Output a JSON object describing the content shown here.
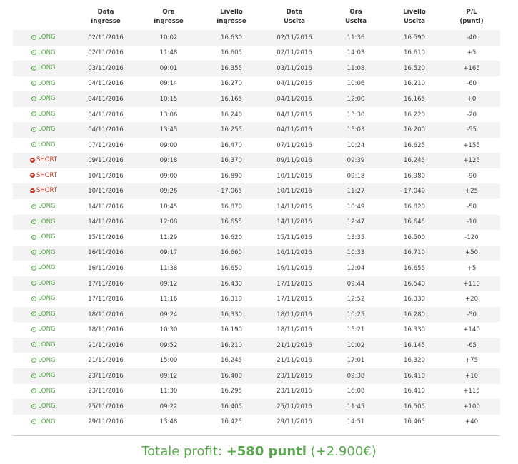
{
  "colors": {
    "positive": "#5aa84d",
    "negative": "#c0392b",
    "row_alt": "#f3f3f3"
  },
  "headers": {
    "direction": "",
    "entry_date": [
      "Data",
      "Ingresso"
    ],
    "entry_time": [
      "Ora",
      "Ingresso"
    ],
    "entry_level": [
      "Livello",
      "Ingresso"
    ],
    "exit_date": [
      "Data",
      "Uscita"
    ],
    "exit_time": [
      "Ora",
      "Uscita"
    ],
    "exit_level": [
      "Livello",
      "Uscita"
    ],
    "pl": [
      "P/L",
      "(punti)"
    ]
  },
  "trades": [
    {
      "dir": "LONG",
      "entry_date": "02/11/2016",
      "entry_time": "10:02",
      "entry_level": "16.630",
      "exit_date": "02/11/2016",
      "exit_time": "11:36",
      "exit_level": "16.590",
      "pl": "-40"
    },
    {
      "dir": "LONG",
      "entry_date": "02/11/2016",
      "entry_time": "11:48",
      "entry_level": "16.605",
      "exit_date": "02/11/2016",
      "exit_time": "14:03",
      "exit_level": "16.610",
      "pl": "+5"
    },
    {
      "dir": "LONG",
      "entry_date": "03/11/2016",
      "entry_time": "09:01",
      "entry_level": "16.355",
      "exit_date": "03/11/2016",
      "exit_time": "11:08",
      "exit_level": "16.520",
      "pl": "+165"
    },
    {
      "dir": "LONG",
      "entry_date": "04/11/2016",
      "entry_time": "09:14",
      "entry_level": "16.270",
      "exit_date": "04/11/2016",
      "exit_time": "10:06",
      "exit_level": "16.210",
      "pl": "-60"
    },
    {
      "dir": "LONG",
      "entry_date": "04/11/2016",
      "entry_time": "10:15",
      "entry_level": "16.165",
      "exit_date": "04/11/2016",
      "exit_time": "12:00",
      "exit_level": "16.165",
      "pl": "+0"
    },
    {
      "dir": "LONG",
      "entry_date": "04/11/2016",
      "entry_time": "13:06",
      "entry_level": "16.240",
      "exit_date": "04/11/2016",
      "exit_time": "13:30",
      "exit_level": "16.220",
      "pl": "-20"
    },
    {
      "dir": "LONG",
      "entry_date": "04/11/2016",
      "entry_time": "13:45",
      "entry_level": "16.255",
      "exit_date": "04/11/2016",
      "exit_time": "15:03",
      "exit_level": "16.200",
      "pl": "-55"
    },
    {
      "dir": "LONG",
      "entry_date": "07/11/2016",
      "entry_time": "09:00",
      "entry_level": "16.470",
      "exit_date": "07/11/2016",
      "exit_time": "10:24",
      "exit_level": "16.625",
      "pl": "+155"
    },
    {
      "dir": "SHORT",
      "entry_date": "09/11/2016",
      "entry_time": "09:18",
      "entry_level": "16.370",
      "exit_date": "09/11/2016",
      "exit_time": "09:39",
      "exit_level": "16.245",
      "pl": "+125"
    },
    {
      "dir": "SHORT",
      "entry_date": "10/11/2016",
      "entry_time": "09:00",
      "entry_level": "16.890",
      "exit_date": "10/11/2016",
      "exit_time": "09:18",
      "exit_level": "16.980",
      "pl": "-90"
    },
    {
      "dir": "SHORT",
      "entry_date": "10/11/2016",
      "entry_time": "09:26",
      "entry_level": "17.065",
      "exit_date": "10/11/2016",
      "exit_time": "11:27",
      "exit_level": "17.040",
      "pl": "+25"
    },
    {
      "dir": "LONG",
      "entry_date": "14/11/2016",
      "entry_time": "10:45",
      "entry_level": "16.870",
      "exit_date": "14/11/2016",
      "exit_time": "10:49",
      "exit_level": "16.820",
      "pl": "-50"
    },
    {
      "dir": "LONG",
      "entry_date": "14/11/2016",
      "entry_time": "12:08",
      "entry_level": "16.655",
      "exit_date": "14/11/2016",
      "exit_time": "12:47",
      "exit_level": "16.645",
      "pl": "-10"
    },
    {
      "dir": "LONG",
      "entry_date": "15/11/2016",
      "entry_time": "11:29",
      "entry_level": "16.620",
      "exit_date": "15/11/2016",
      "exit_time": "13:35",
      "exit_level": "16.500",
      "pl": "-120"
    },
    {
      "dir": "LONG",
      "entry_date": "16/11/2016",
      "entry_time": "09:17",
      "entry_level": "16.660",
      "exit_date": "16/11/2016",
      "exit_time": "10:33",
      "exit_level": "16.710",
      "pl": "+50"
    },
    {
      "dir": "LONG",
      "entry_date": "16/11/2016",
      "entry_time": "11:38",
      "entry_level": "16.650",
      "exit_date": "16/11/2016",
      "exit_time": "12:04",
      "exit_level": "16.655",
      "pl": "+5"
    },
    {
      "dir": "LONG",
      "entry_date": "17/11/2016",
      "entry_time": "09:12",
      "entry_level": "16.430",
      "exit_date": "17/11/2016",
      "exit_time": "09:44",
      "exit_level": "16.540",
      "pl": "+110"
    },
    {
      "dir": "LONG",
      "entry_date": "17/11/2016",
      "entry_time": "11:16",
      "entry_level": "16.310",
      "exit_date": "17/11/2016",
      "exit_time": "12:52",
      "exit_level": "16.330",
      "pl": "+20"
    },
    {
      "dir": "LONG",
      "entry_date": "18/11/2016",
      "entry_time": "09:24",
      "entry_level": "16.330",
      "exit_date": "18/11/2016",
      "exit_time": "10:25",
      "exit_level": "16.280",
      "pl": "-50"
    },
    {
      "dir": "LONG",
      "entry_date": "18/11/2016",
      "entry_time": "10:30",
      "entry_level": "16.190",
      "exit_date": "18/11/2016",
      "exit_time": "15:21",
      "exit_level": "16.330",
      "pl": "+140"
    },
    {
      "dir": "LONG",
      "entry_date": "21/11/2016",
      "entry_time": "09:52",
      "entry_level": "16.210",
      "exit_date": "21/11/2016",
      "exit_time": "10:02",
      "exit_level": "16.145",
      "pl": "-65"
    },
    {
      "dir": "LONG",
      "entry_date": "21/11/2016",
      "entry_time": "15:00",
      "entry_level": "16.245",
      "exit_date": "21/11/2016",
      "exit_time": "17:01",
      "exit_level": "16.320",
      "pl": "+75"
    },
    {
      "dir": "LONG",
      "entry_date": "23/11/2016",
      "entry_time": "09:12",
      "entry_level": "16.400",
      "exit_date": "23/11/2016",
      "exit_time": "09:38",
      "exit_level": "16.410",
      "pl": "+10"
    },
    {
      "dir": "LONG",
      "entry_date": "23/11/2016",
      "entry_time": "11:30",
      "entry_level": "16.295",
      "exit_date": "23/11/2016",
      "exit_time": "16:08",
      "exit_level": "16.410",
      "pl": "+115"
    },
    {
      "dir": "LONG",
      "entry_date": "25/11/2016",
      "entry_time": "09:22",
      "entry_level": "16.405",
      "exit_date": "25/11/2016",
      "exit_time": "11:45",
      "exit_level": "16.505",
      "pl": "+100"
    },
    {
      "dir": "LONG",
      "entry_date": "29/11/2016",
      "entry_time": "13:48",
      "entry_level": "16.425",
      "exit_date": "29/11/2016",
      "exit_time": "14:51",
      "exit_level": "16.465",
      "pl": "+40"
    }
  ],
  "total": {
    "label": "Totale profit: ",
    "points": "+580 punti",
    "euro": " (+2.900€)"
  }
}
